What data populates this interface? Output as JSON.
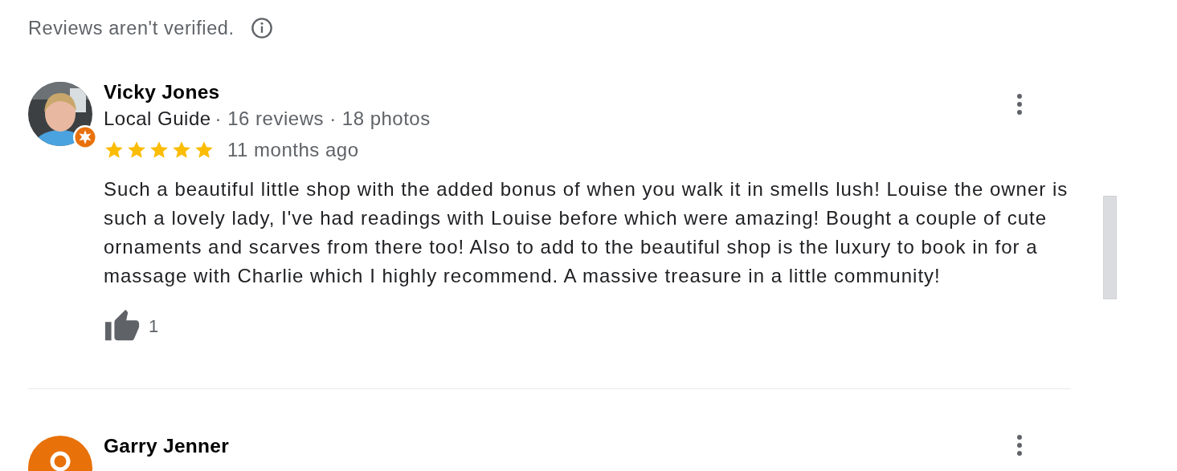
{
  "notice": "Reviews aren't verified.",
  "reviews": [
    {
      "name": "Vicky Jones",
      "guide_label": "Local Guide",
      "stats": "· 16 reviews · 18 photos",
      "stars": 5,
      "time": "11 months ago",
      "text": "Such a beautiful little shop with the added bonus of when you walk it in smells lush! Louise the owner is such a lovely lady, I've had readings with Louise before which were amazing! Bought a couple of cute ornaments and scarves from there too! Also to add to the beautiful shop is the luxury to book in for a massage with Charlie which I highly recommend. A massive treasure in a little community!",
      "likes": "1"
    },
    {
      "avatar": {
        "kind": "default",
        "color": "#e8710a"
      },
      "name": "Garry Jenner"
    }
  ]
}
